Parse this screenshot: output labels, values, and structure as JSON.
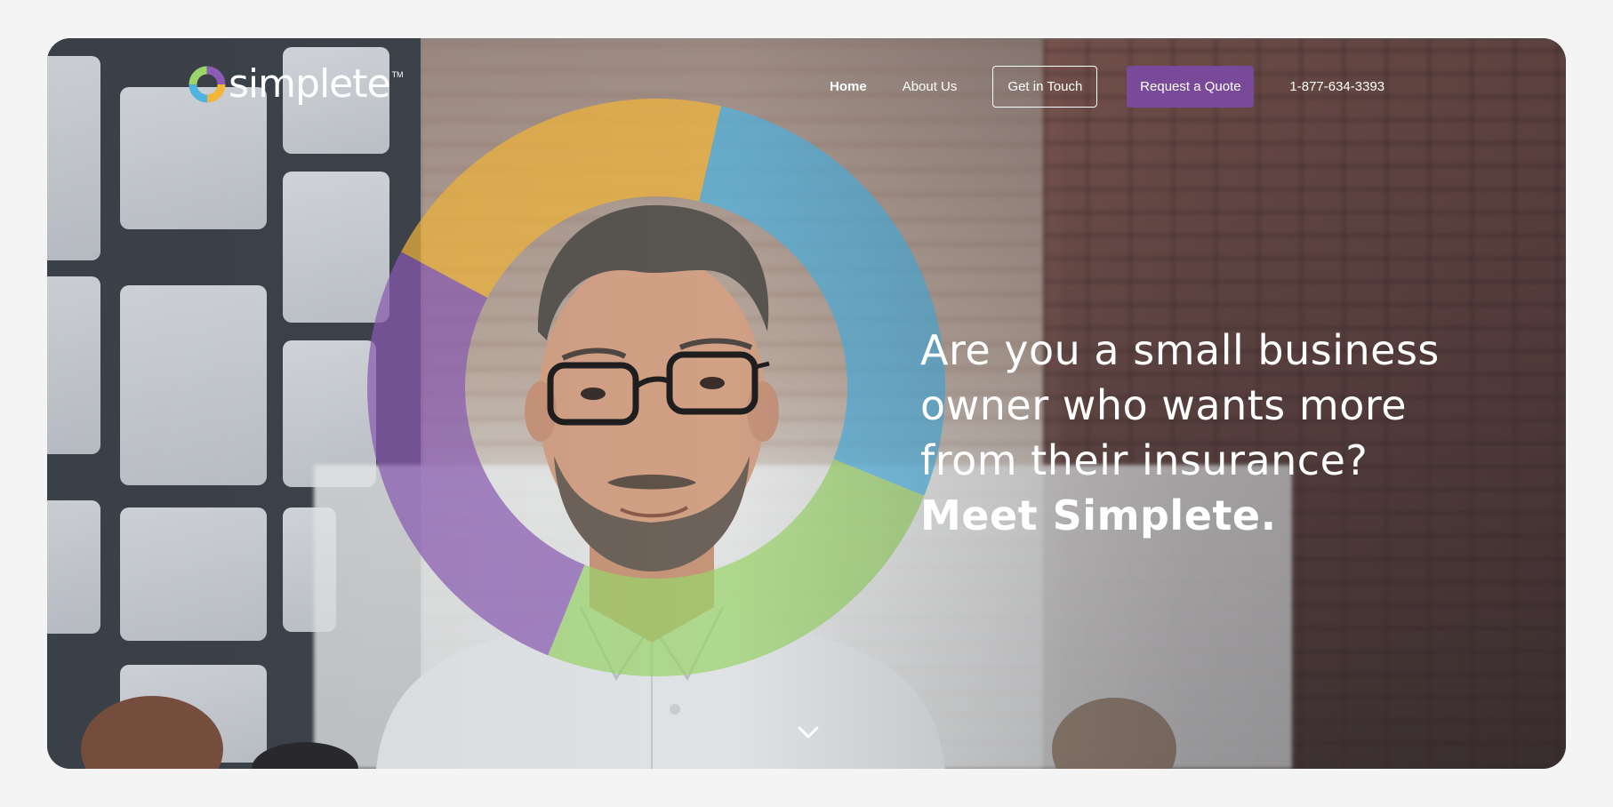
{
  "brand": {
    "name": "simplete",
    "trademark": "TM",
    "ring_colors": [
      "#f2b63a",
      "#4fb3e0",
      "#9bd46b",
      "#8a5cb3"
    ]
  },
  "nav": {
    "home": "Home",
    "about": "About Us",
    "contact_button": "Get in Touch",
    "quote_button": "Request a Quote",
    "phone": "1-877-634-3393"
  },
  "hero": {
    "headline_lines": [
      "Are you a small business",
      "owner who wants more",
      "from their insurance?"
    ],
    "headline_emphasis": "Meet Simplete.",
    "scroll_icon": "chevron-down-icon"
  },
  "colors": {
    "accent_purple": "#7a4a9a",
    "text_white": "#ffffff"
  }
}
